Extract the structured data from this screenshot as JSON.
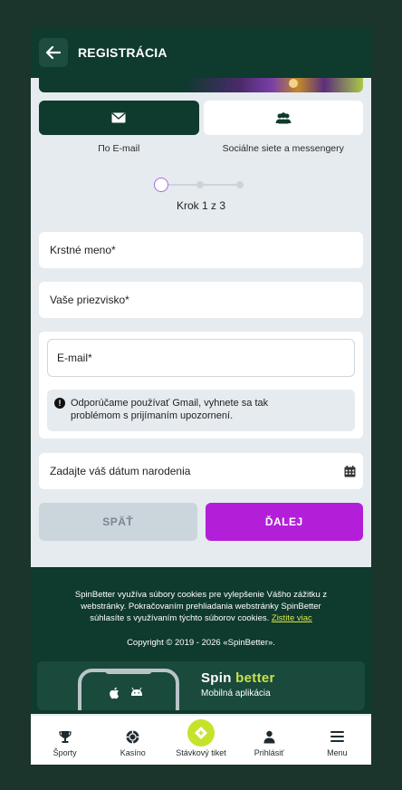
{
  "header": {
    "title": "REGISTRÁCIA"
  },
  "tabs": [
    {
      "label": "По E-mail",
      "icon": "envelope-icon"
    },
    {
      "label": "Sociálne siete a messengery",
      "icon": "users-icon"
    }
  ],
  "stepper": {
    "text": "Krok 1 z 3",
    "current": 1,
    "total": 3
  },
  "form": {
    "first_name": "Krstné meno*",
    "last_name": "Vaše priezvisko*",
    "email": "E-mail*",
    "notice_line1": "Odporúčame používať Gmail, vyhnete sa tak",
    "notice_line2": "problémom s prijímaním upozornení.",
    "birthdate": "Zadajte váš dátum narodenia"
  },
  "buttons": {
    "back": "SPÄŤ",
    "next": "ĎALEJ"
  },
  "footer": {
    "cookie_line1": "SpinBetter využíva súbory cookies pre vylepšenie Vášho zážitku z",
    "cookie_line2": "webstránky. Pokračovaním prehliadania webstránky SpinBetter",
    "cookie_line3": "súhlasíte s využívaním týchto súborov cookies.",
    "cookie_link": "Zistite viac",
    "copyright": "Copyright © 2019 - 2026 «SpinBetter».",
    "brand_spin": "Spin",
    "brand_better": "better",
    "app_label": "Mobilná aplikácia"
  },
  "nav": [
    {
      "label": "Športy",
      "icon": "trophy-icon"
    },
    {
      "label": "Kasíno",
      "icon": "casino-chip-icon"
    },
    {
      "label": "Stávkový tiket",
      "icon": "bet-slip-icon"
    },
    {
      "label": "Prihlásiť",
      "icon": "user-icon"
    },
    {
      "label": "Menu",
      "icon": "menu-icon"
    }
  ],
  "colors": {
    "brand_dark": "#0f3a2e",
    "accent_purple": "#b31fd8",
    "accent_lime": "#c7e22b",
    "background": "#e6ebef"
  }
}
